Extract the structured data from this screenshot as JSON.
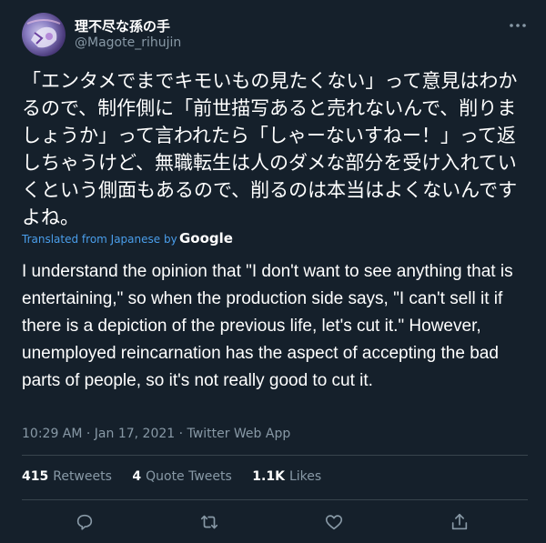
{
  "tweet": {
    "display_name": "理不尽な孫の手",
    "handle": "@Magote_rihujin",
    "original_text": "「エンタメでまでキモいもの見たくない」って意見はわかるので、制作側に「前世描写あると売れないんで、削りましょうか」って言われたら「しゃーないすねー！」って返しちゃうけど、無職転生は人のダメな部分を受け入れていくという側面もあるので、削るのは本当はよくないんですよね。",
    "translated_label": "Translated from Japanese by",
    "translator": "Google",
    "translation": "I understand the opinion that \"I don't want to see anything that is entertaining,\" so when the production side says, \"I can't sell it if there is a depiction of the previous life, let's cut it.\" However, unemployed reincarnation has the aspect of accepting the bad parts of people, so it's not really good to cut it.",
    "timestamp": "10:29 AM · Jan 17, 2021 · Twitter Web App"
  },
  "stats": {
    "retweets_count": "415",
    "retweets_label": "Retweets",
    "quotes_count": "4",
    "quotes_label": "Quote Tweets",
    "likes_count": "1.1K",
    "likes_label": "Likes"
  },
  "actions": {
    "icons": [
      "reply-icon",
      "retweet-icon",
      "like-icon",
      "share-icon"
    ]
  },
  "colors": {
    "background": "#15202b",
    "text": "#ffffff",
    "secondary": "#8899a6",
    "link": "#4a9eeb",
    "divider": "#38444d"
  }
}
